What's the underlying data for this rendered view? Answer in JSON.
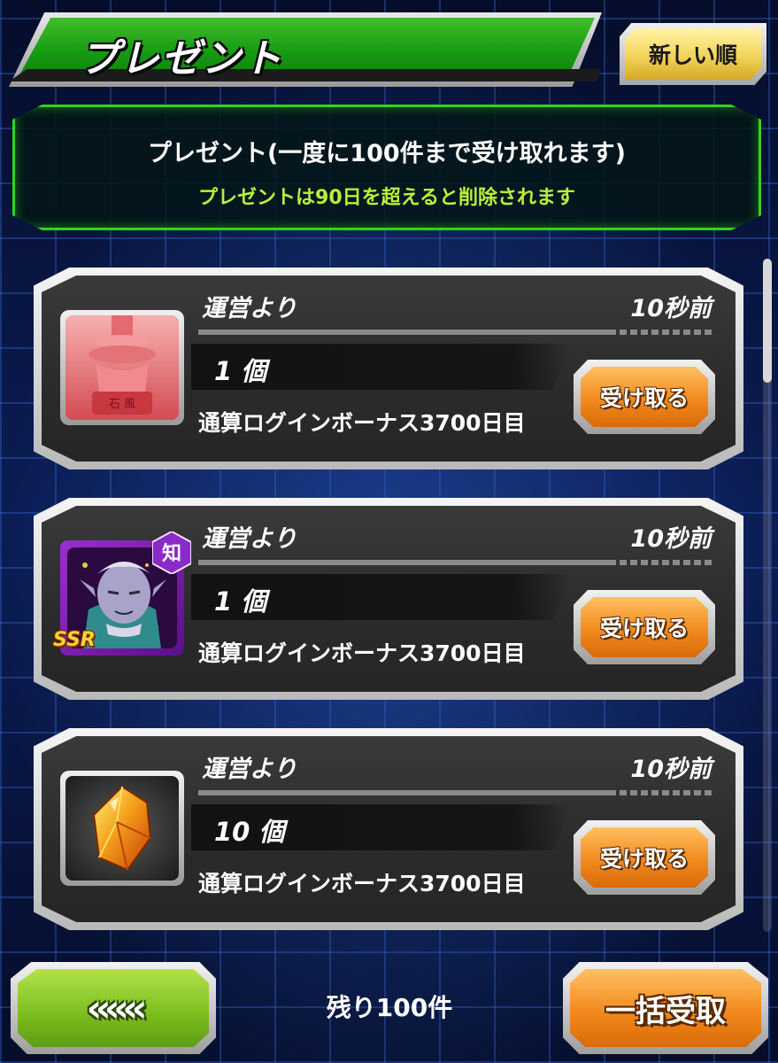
{
  "header": {
    "title": "プレゼント",
    "sort_label": "新しい順"
  },
  "notice": {
    "main": "プレゼント(一度に100件まで受け取れます)",
    "sub": "プレゼントは90日を超えると削除されます"
  },
  "presents": [
    {
      "from": "運営より",
      "time": "10秒前",
      "quantity": "1 個",
      "description": "通算ログインボーナス3700日目",
      "button": "受け取る",
      "icon": "red-potara-item-icon"
    },
    {
      "from": "運営より",
      "time": "10秒前",
      "quantity": "1 個",
      "description": "通算ログインボーナス3700日目",
      "button": "受け取る",
      "icon": "character-card-icon",
      "rarity": "SSR",
      "type_badge": "知"
    },
    {
      "from": "運営より",
      "time": "10秒前",
      "quantity": "10 個",
      "description": "通算ログインボーナス3700日目",
      "button": "受け取る",
      "icon": "orange-crystal-icon"
    }
  ],
  "footer": {
    "back_label": "«««",
    "remaining": "残り100件",
    "bulk_label": "一括受取"
  },
  "colors": {
    "accent_green": "#32d41a",
    "notice_sub": "#b8f03a",
    "orange_button": "#f28a1e",
    "back_button": "#7ec020"
  }
}
